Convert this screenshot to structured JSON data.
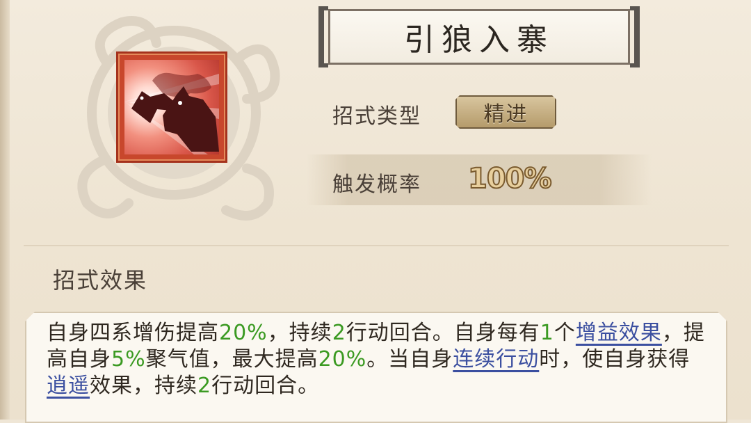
{
  "skill": {
    "name": "引狼入寨",
    "type_label": "招式类型",
    "type_value": "精进",
    "rate_label": "触发概率",
    "rate_value": "100%"
  },
  "effect": {
    "section_title": "招式效果",
    "segments": {
      "s1": "自身四系增伤提高",
      "n1": "20%",
      "s2": "，持续",
      "n2": "2",
      "s3": "行动回合。自身每有",
      "n3": "1",
      "s4": "个",
      "k1": "增益效果",
      "s5": "，提高自身",
      "n4": "5%",
      "s6": "聚气值，最大提高",
      "n5": "20%",
      "s7": "。当自身",
      "k2": "连续行动",
      "s8": "时，使自身获得",
      "k3": "逍遥",
      "s9": "效果，持续",
      "n6": "2",
      "s10": "行动回合。"
    }
  },
  "icons": {
    "skill_icon": "wolves-howling-icon",
    "emblem": "cloud-swirl-emblem"
  },
  "colors": {
    "highlight_number": "#3b9a22",
    "keyword_link": "#3b4fa0",
    "icon_frame": "#c8472c"
  }
}
